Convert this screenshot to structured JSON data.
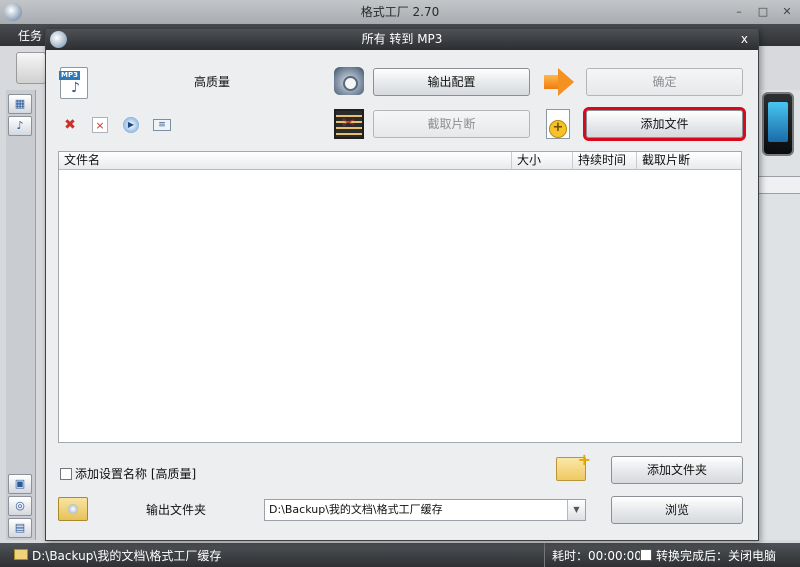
{
  "main_window": {
    "title": "格式工厂 2.70",
    "menu_first": "任务",
    "status_path": "D:\\Backup\\我的文档\\格式工厂缓存",
    "status_time": "耗时：00:00:00",
    "status_after": "转换完成后：关闭电脑"
  },
  "dialog": {
    "title": "所有 转到 MP3",
    "close_label": "x",
    "quality": "高质量",
    "output_config_label": "输出配置",
    "ok_label": "确定",
    "clip_label": "截取片断",
    "add_file_label": "添加文件",
    "add_folder_label": "添加文件夹",
    "add_name_label": "添加设置名称 [高质量]",
    "output_folder_label": "输出文件夹",
    "output_path": "D:\\Backup\\我的文档\\格式工厂缓存",
    "browse_label": "浏览",
    "mp3_tag": "MP3"
  },
  "table": {
    "columns": [
      "文件名",
      "大小",
      "持续时间",
      "截取片断"
    ]
  },
  "colors": {
    "highlight_border": "#d9091c",
    "title_bar": "#2c2e31"
  }
}
